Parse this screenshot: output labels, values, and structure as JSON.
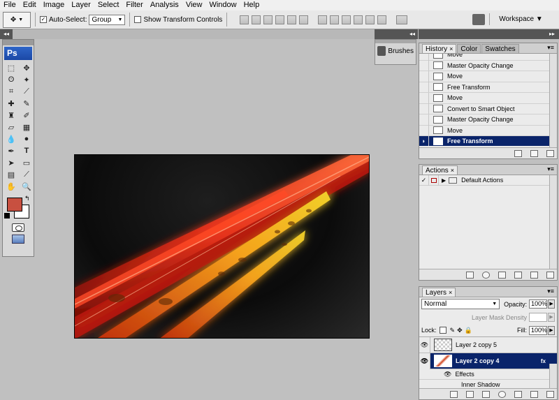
{
  "menu": [
    "File",
    "Edit",
    "Image",
    "Layer",
    "Select",
    "Filter",
    "Analysis",
    "View",
    "Window",
    "Help"
  ],
  "options": {
    "auto_select_label": "Auto-Select:",
    "auto_select_checked": "✓",
    "auto_select_value": "Group",
    "show_transform_label": "Show Transform Controls",
    "workspace_label": "Workspace ▼"
  },
  "toolbox": {
    "logo": "Ps",
    "foreground_color": "#c85040",
    "background_color": "#ffffff"
  },
  "brushes": {
    "label": "Brushes"
  },
  "history": {
    "tabs": [
      "History",
      "Color",
      "Swatches"
    ],
    "items": [
      {
        "icon": "move-tool-icon",
        "label": "Move"
      },
      {
        "icon": "document-icon",
        "label": "Master Opacity Change"
      },
      {
        "icon": "move-tool-icon",
        "label": "Move"
      },
      {
        "icon": "document-icon",
        "label": "Free Transform"
      },
      {
        "icon": "move-tool-icon",
        "label": "Move"
      },
      {
        "icon": "document-icon",
        "label": "Convert to Smart Object"
      },
      {
        "icon": "document-icon",
        "label": "Master Opacity Change"
      },
      {
        "icon": "move-tool-icon",
        "label": "Move"
      },
      {
        "icon": "document-icon",
        "label": "Free Transform"
      }
    ],
    "selected_index": 8
  },
  "actions": {
    "tab": "Actions",
    "item_checked": "✓",
    "item_expand": "▶",
    "item_label": "Default Actions"
  },
  "layers": {
    "tab": "Layers",
    "blend_mode": "Normal",
    "opacity_label": "Opacity:",
    "opacity_value": "100%",
    "mask_density_label": "Layer Mask Density",
    "lock_label": "Lock:",
    "fill_label": "Fill:",
    "fill_value": "100%",
    "rows": [
      {
        "name": "Layer 2 copy 5",
        "visible": "👁"
      },
      {
        "name": "Layer 2 copy 4",
        "visible": "👁"
      }
    ],
    "effects_label": "Effects",
    "effect_item": "Inner Shadow"
  },
  "colors": {
    "selection": "#0a246a",
    "canvas_bg": "#0b0b0b",
    "streak_red": "#e8321a",
    "streak_orange": "#f5a21c",
    "streak_yellow": "#e9c71e"
  }
}
